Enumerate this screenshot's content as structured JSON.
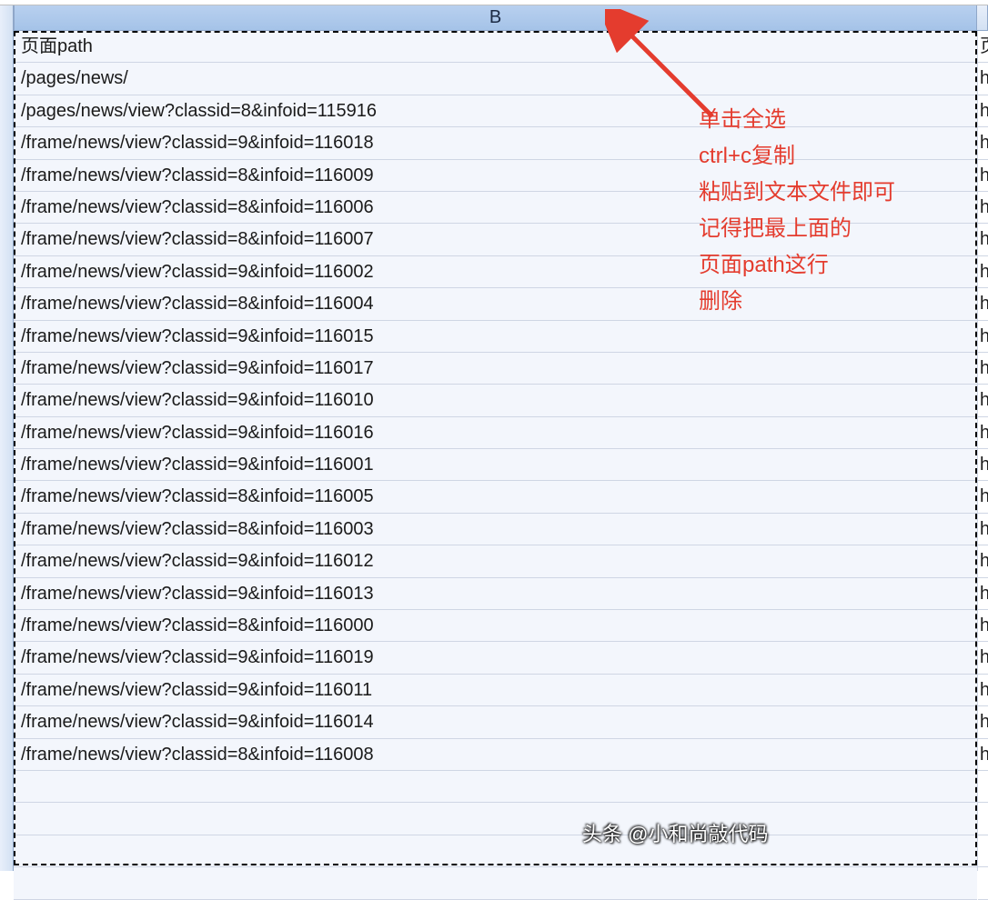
{
  "column_header": "B",
  "next_column_letter_partial": "",
  "rows": [
    "页面path",
    "/pages/news/",
    "/pages/news/view?classid=8&infoid=115916",
    "/frame/news/view?classid=9&infoid=116018",
    "/frame/news/view?classid=8&infoid=116009",
    "/frame/news/view?classid=8&infoid=116006",
    "/frame/news/view?classid=8&infoid=116007",
    "/frame/news/view?classid=9&infoid=116002",
    "/frame/news/view?classid=8&infoid=116004",
    "/frame/news/view?classid=9&infoid=116015",
    "/frame/news/view?classid=9&infoid=116017",
    "/frame/news/view?classid=9&infoid=116010",
    "/frame/news/view?classid=9&infoid=116016",
    "/frame/news/view?classid=9&infoid=116001",
    "/frame/news/view?classid=8&infoid=116005",
    "/frame/news/view?classid=8&infoid=116003",
    "/frame/news/view?classid=9&infoid=116012",
    "/frame/news/view?classid=9&infoid=116013",
    "/frame/news/view?classid=8&infoid=116000",
    "/frame/news/view?classid=9&infoid=116019",
    "/frame/news/view?classid=9&infoid=116011",
    "/frame/news/view?classid=9&infoid=116014",
    "/frame/news/view?classid=8&infoid=116008",
    "",
    "",
    "",
    ""
  ],
  "next_col_cells": [
    "页",
    "h",
    "h",
    "h",
    "h",
    "h",
    "h",
    "h",
    "h",
    "h",
    "h",
    "h",
    "h",
    "h",
    "h",
    "h",
    "h",
    "h",
    "h",
    "h",
    "h",
    "h",
    "h",
    "",
    "",
    "",
    ""
  ],
  "annotation_lines": [
    "单击全选",
    "ctrl+c复制",
    "粘贴到文本文件即可",
    "记得把最上面的",
    "页面path这行",
    "删除"
  ],
  "watermark": "头条 @小和尚敲代码"
}
